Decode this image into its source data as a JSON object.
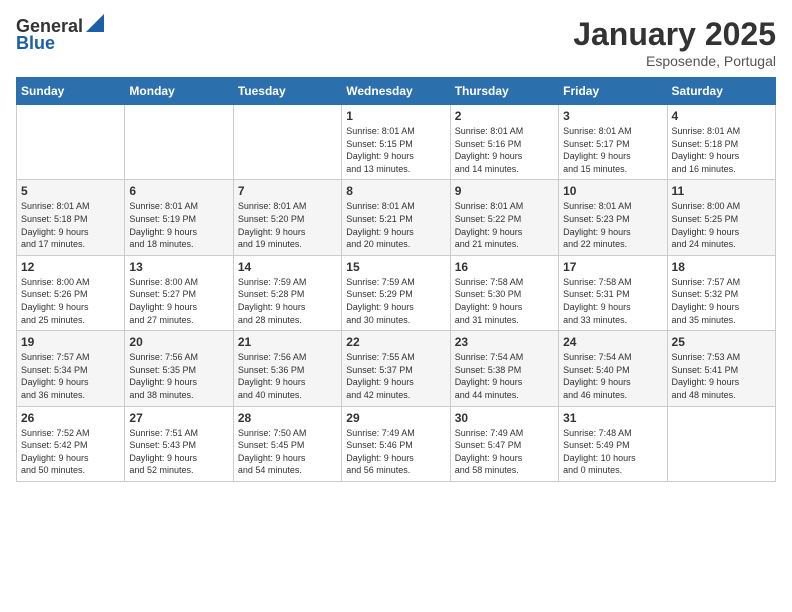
{
  "header": {
    "logo_general": "General",
    "logo_blue": "Blue",
    "month": "January 2025",
    "location": "Esposende, Portugal"
  },
  "weekdays": [
    "Sunday",
    "Monday",
    "Tuesday",
    "Wednesday",
    "Thursday",
    "Friday",
    "Saturday"
  ],
  "weeks": [
    [
      {
        "day": "",
        "info": ""
      },
      {
        "day": "",
        "info": ""
      },
      {
        "day": "",
        "info": ""
      },
      {
        "day": "1",
        "info": "Sunrise: 8:01 AM\nSunset: 5:15 PM\nDaylight: 9 hours\nand 13 minutes."
      },
      {
        "day": "2",
        "info": "Sunrise: 8:01 AM\nSunset: 5:16 PM\nDaylight: 9 hours\nand 14 minutes."
      },
      {
        "day": "3",
        "info": "Sunrise: 8:01 AM\nSunset: 5:17 PM\nDaylight: 9 hours\nand 15 minutes."
      },
      {
        "day": "4",
        "info": "Sunrise: 8:01 AM\nSunset: 5:18 PM\nDaylight: 9 hours\nand 16 minutes."
      }
    ],
    [
      {
        "day": "5",
        "info": "Sunrise: 8:01 AM\nSunset: 5:18 PM\nDaylight: 9 hours\nand 17 minutes."
      },
      {
        "day": "6",
        "info": "Sunrise: 8:01 AM\nSunset: 5:19 PM\nDaylight: 9 hours\nand 18 minutes."
      },
      {
        "day": "7",
        "info": "Sunrise: 8:01 AM\nSunset: 5:20 PM\nDaylight: 9 hours\nand 19 minutes."
      },
      {
        "day": "8",
        "info": "Sunrise: 8:01 AM\nSunset: 5:21 PM\nDaylight: 9 hours\nand 20 minutes."
      },
      {
        "day": "9",
        "info": "Sunrise: 8:01 AM\nSunset: 5:22 PM\nDaylight: 9 hours\nand 21 minutes."
      },
      {
        "day": "10",
        "info": "Sunrise: 8:01 AM\nSunset: 5:23 PM\nDaylight: 9 hours\nand 22 minutes."
      },
      {
        "day": "11",
        "info": "Sunrise: 8:00 AM\nSunset: 5:25 PM\nDaylight: 9 hours\nand 24 minutes."
      }
    ],
    [
      {
        "day": "12",
        "info": "Sunrise: 8:00 AM\nSunset: 5:26 PM\nDaylight: 9 hours\nand 25 minutes."
      },
      {
        "day": "13",
        "info": "Sunrise: 8:00 AM\nSunset: 5:27 PM\nDaylight: 9 hours\nand 27 minutes."
      },
      {
        "day": "14",
        "info": "Sunrise: 7:59 AM\nSunset: 5:28 PM\nDaylight: 9 hours\nand 28 minutes."
      },
      {
        "day": "15",
        "info": "Sunrise: 7:59 AM\nSunset: 5:29 PM\nDaylight: 9 hours\nand 30 minutes."
      },
      {
        "day": "16",
        "info": "Sunrise: 7:58 AM\nSunset: 5:30 PM\nDaylight: 9 hours\nand 31 minutes."
      },
      {
        "day": "17",
        "info": "Sunrise: 7:58 AM\nSunset: 5:31 PM\nDaylight: 9 hours\nand 33 minutes."
      },
      {
        "day": "18",
        "info": "Sunrise: 7:57 AM\nSunset: 5:32 PM\nDaylight: 9 hours\nand 35 minutes."
      }
    ],
    [
      {
        "day": "19",
        "info": "Sunrise: 7:57 AM\nSunset: 5:34 PM\nDaylight: 9 hours\nand 36 minutes."
      },
      {
        "day": "20",
        "info": "Sunrise: 7:56 AM\nSunset: 5:35 PM\nDaylight: 9 hours\nand 38 minutes."
      },
      {
        "day": "21",
        "info": "Sunrise: 7:56 AM\nSunset: 5:36 PM\nDaylight: 9 hours\nand 40 minutes."
      },
      {
        "day": "22",
        "info": "Sunrise: 7:55 AM\nSunset: 5:37 PM\nDaylight: 9 hours\nand 42 minutes."
      },
      {
        "day": "23",
        "info": "Sunrise: 7:54 AM\nSunset: 5:38 PM\nDaylight: 9 hours\nand 44 minutes."
      },
      {
        "day": "24",
        "info": "Sunrise: 7:54 AM\nSunset: 5:40 PM\nDaylight: 9 hours\nand 46 minutes."
      },
      {
        "day": "25",
        "info": "Sunrise: 7:53 AM\nSunset: 5:41 PM\nDaylight: 9 hours\nand 48 minutes."
      }
    ],
    [
      {
        "day": "26",
        "info": "Sunrise: 7:52 AM\nSunset: 5:42 PM\nDaylight: 9 hours\nand 50 minutes."
      },
      {
        "day": "27",
        "info": "Sunrise: 7:51 AM\nSunset: 5:43 PM\nDaylight: 9 hours\nand 52 minutes."
      },
      {
        "day": "28",
        "info": "Sunrise: 7:50 AM\nSunset: 5:45 PM\nDaylight: 9 hours\nand 54 minutes."
      },
      {
        "day": "29",
        "info": "Sunrise: 7:49 AM\nSunset: 5:46 PM\nDaylight: 9 hours\nand 56 minutes."
      },
      {
        "day": "30",
        "info": "Sunrise: 7:49 AM\nSunset: 5:47 PM\nDaylight: 9 hours\nand 58 minutes."
      },
      {
        "day": "31",
        "info": "Sunrise: 7:48 AM\nSunset: 5:49 PM\nDaylight: 10 hours\nand 0 minutes."
      },
      {
        "day": "",
        "info": ""
      }
    ]
  ]
}
